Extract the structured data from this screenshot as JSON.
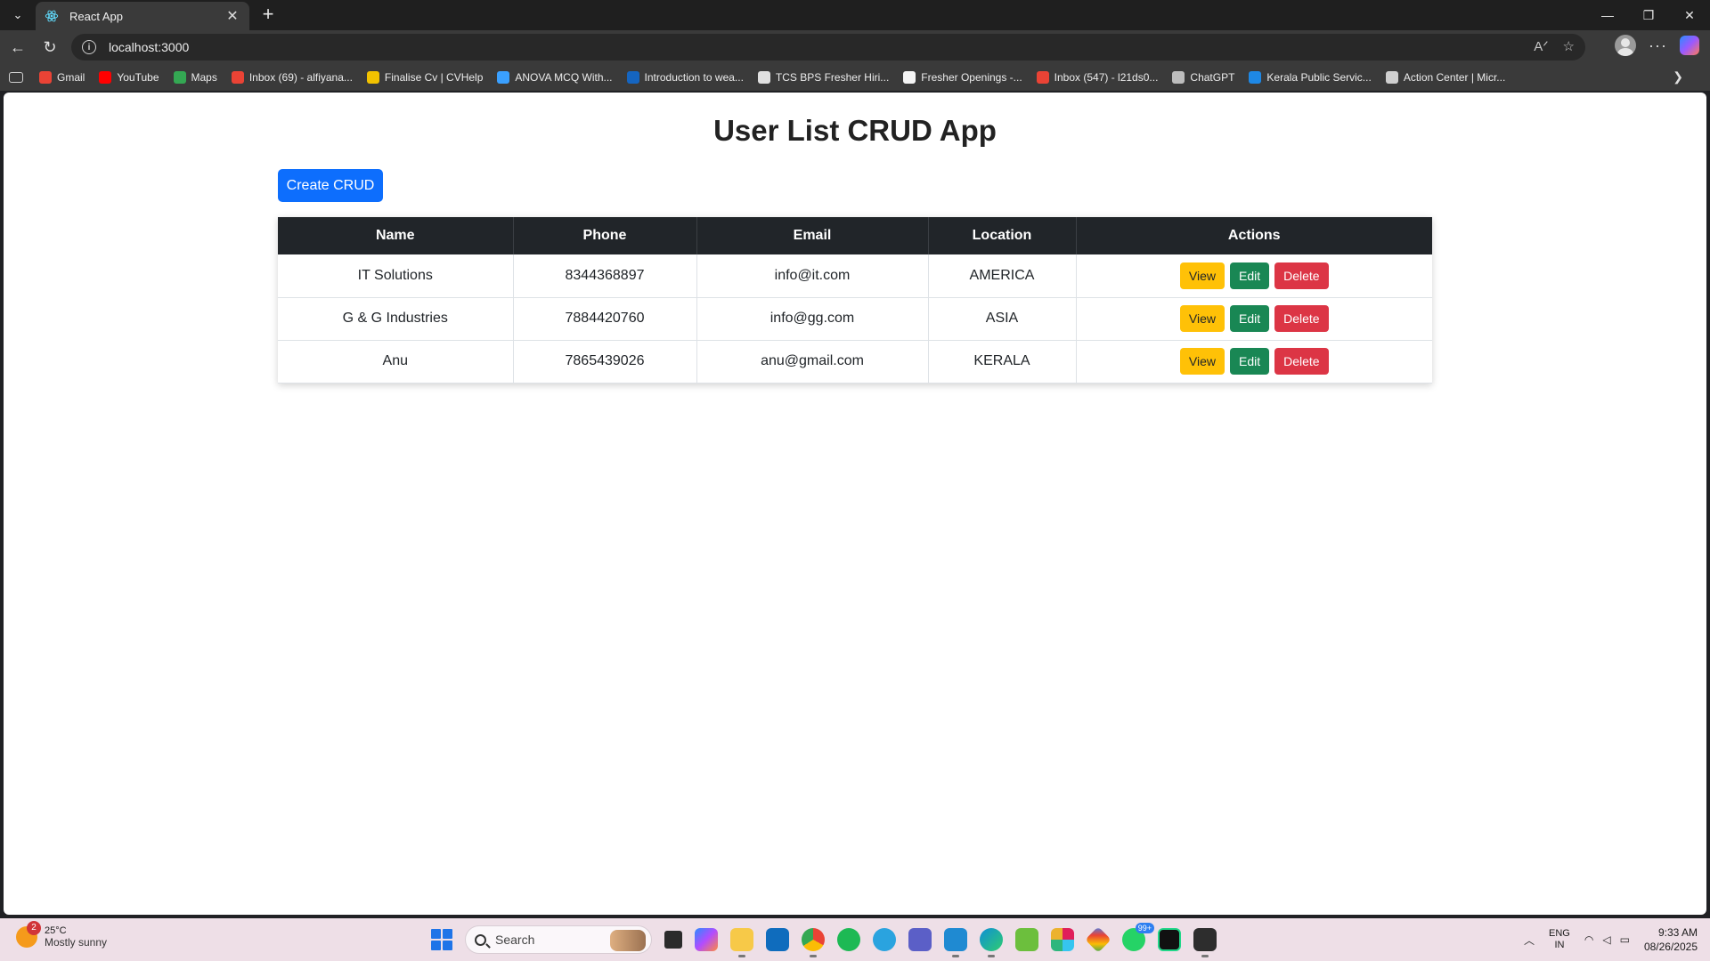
{
  "browser": {
    "tab_title": "React App",
    "url": "localhost:3000",
    "bookmarks": [
      {
        "label": "Gmail",
        "color": "#ea4335"
      },
      {
        "label": "YouTube",
        "color": "#ff0000"
      },
      {
        "label": "Maps",
        "color": "#34a853"
      },
      {
        "label": "Inbox (69) - alfiyana...",
        "color": "#ea4335"
      },
      {
        "label": "Finalise Cv | CVHelp",
        "color": "#f2c200"
      },
      {
        "label": "ANOVA MCQ With...",
        "color": "#3aa0ff"
      },
      {
        "label": "Introduction to wea...",
        "color": "#1565c0"
      },
      {
        "label": "TCS BPS Fresher Hiri...",
        "color": "#e0e0e0"
      },
      {
        "label": "Fresher Openings -...",
        "color": "#f5f5f5"
      },
      {
        "label": "Inbox (547) - l21ds0...",
        "color": "#ea4335"
      },
      {
        "label": "ChatGPT",
        "color": "#bdbdbd"
      },
      {
        "label": "Kerala Public Servic...",
        "color": "#1e88e5"
      },
      {
        "label": "Action Center | Micr...",
        "color": "#cfcfcf"
      }
    ]
  },
  "app": {
    "title": "User List CRUD App",
    "create_label": "Create CRUD",
    "columns": [
      "Name",
      "Phone",
      "Email",
      "Location",
      "Actions"
    ],
    "action_labels": {
      "view": "View",
      "edit": "Edit",
      "delete": "Delete"
    },
    "rows": [
      {
        "name": "IT Solutions",
        "phone": "8344368897",
        "email": "info@it.com",
        "location": "AMERICA"
      },
      {
        "name": "G & G Industries",
        "phone": "7884420760",
        "email": "info@gg.com",
        "location": "ASIA"
      },
      {
        "name": "Anu",
        "phone": "7865439026",
        "email": "anu@gmail.com",
        "location": "KERALA"
      }
    ]
  },
  "taskbar": {
    "weather_badge": "2",
    "weather_temp": "25°C",
    "weather_desc": "Mostly sunny",
    "search_placeholder": "Search",
    "whatsapp_badge": "99+",
    "lang_top": "ENG",
    "lang_bottom": "IN",
    "time": "9:33 AM",
    "date": "08/26/2025"
  },
  "colors": {
    "primary": "#0d6efd",
    "warning": "#ffc107",
    "success": "#198754",
    "danger": "#dc3545",
    "table_header": "#212529"
  }
}
